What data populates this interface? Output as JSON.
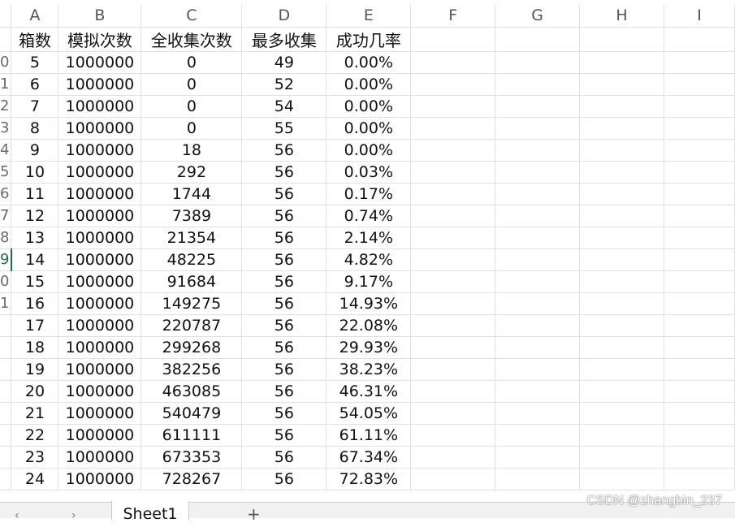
{
  "columns": [
    "A",
    "B",
    "C",
    "D",
    "E",
    "F",
    "G",
    "H",
    "I"
  ],
  "row_labels": [
    "",
    "0",
    "1",
    "2",
    "3",
    "4",
    "5",
    "6",
    "7",
    "8",
    "9",
    "0",
    "1"
  ],
  "headers": [
    "箱数",
    "模拟次数",
    "全收集次数",
    "最多收集",
    "成功几率"
  ],
  "rows": [
    [
      "5",
      "1000000",
      "0",
      "49",
      "0.00%"
    ],
    [
      "6",
      "1000000",
      "0",
      "52",
      "0.00%"
    ],
    [
      "7",
      "1000000",
      "0",
      "54",
      "0.00%"
    ],
    [
      "8",
      "1000000",
      "0",
      "55",
      "0.00%"
    ],
    [
      "9",
      "1000000",
      "18",
      "56",
      "0.00%"
    ],
    [
      "10",
      "1000000",
      "292",
      "56",
      "0.03%"
    ],
    [
      "11",
      "1000000",
      "1744",
      "56",
      "0.17%"
    ],
    [
      "12",
      "1000000",
      "7389",
      "56",
      "0.74%"
    ],
    [
      "13",
      "1000000",
      "21354",
      "56",
      "2.14%"
    ],
    [
      "14",
      "1000000",
      "48225",
      "56",
      "4.82%"
    ],
    [
      "15",
      "1000000",
      "91684",
      "56",
      "9.17%"
    ],
    [
      "16",
      "1000000",
      "149275",
      "56",
      "14.93%"
    ],
    [
      "17",
      "1000000",
      "220787",
      "56",
      "22.08%"
    ],
    [
      "18",
      "1000000",
      "299268",
      "56",
      "29.93%"
    ],
    [
      "19",
      "1000000",
      "382256",
      "56",
      "38.23%"
    ],
    [
      "20",
      "1000000",
      "463085",
      "56",
      "46.31%"
    ],
    [
      "21",
      "1000000",
      "540479",
      "56",
      "54.05%"
    ],
    [
      "22",
      "1000000",
      "611111",
      "56",
      "61.11%"
    ],
    [
      "23",
      "1000000",
      "673353",
      "56",
      "67.34%"
    ],
    [
      "24",
      "1000000",
      "728267",
      "56",
      "72.83%"
    ]
  ],
  "selected_row_label_index": 10,
  "tabs": {
    "sheet_name": "Sheet1",
    "add_label": "+",
    "nav_arrows": "‹ ›"
  },
  "watermark": "CSDN @zhangbin_237",
  "colors": {
    "accent": "#1e7145",
    "grid": "#e1e1e1"
  }
}
